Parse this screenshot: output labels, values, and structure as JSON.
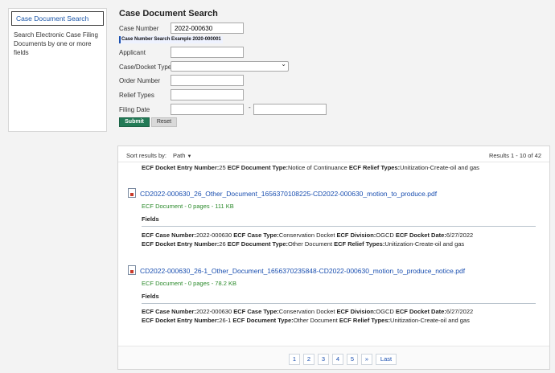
{
  "sidebar": {
    "tab_label": "Case Document Search",
    "description": "Search Electronic Case Filing Documents by one or more fields"
  },
  "form": {
    "title": "Case Document Search",
    "case_number_label": "Case Number",
    "case_number_value": "2022-000630",
    "hint": "Case Number Search Example 2020-000001",
    "applicant_label": "Applicant",
    "case_docket_type_label": "Case/Docket Type",
    "order_number_label": "Order Number",
    "relief_types_label": "Relief Types",
    "filing_date_label": "Filing Date",
    "filing_date_separator": "-",
    "submit_label": "Submit",
    "reset_label": "Reset"
  },
  "results": {
    "sort_label": "Sort results by:",
    "sort_value": "Path",
    "count": "Results  1 - 10 of 42",
    "first_partial": {
      "k1": "ECF Docket Entry Number:",
      "v1": "25",
      "k2": "ECF Document Type:",
      "v2": "Notice of Continuance",
      "k3": "ECF Relief Types:",
      "v3": "Unitization-Create-oil and gas"
    },
    "items": [
      {
        "title": "CD2022-000630_26_Other_Document_1656370108225-CD2022-000630_motion_to_produce.pdf",
        "size": "ECF Document - 0 pages - 111 KB",
        "fields_label": "Fields",
        "line1": {
          "k1": "ECF Case Number:",
          "v1": "2022-000630",
          "k2": "ECF Case Type:",
          "v2": "Conservation Docket",
          "k3": "ECF Division:",
          "v3": "OGCD",
          "k4": "ECF Docket Date:",
          "v4": "6/27/2022"
        },
        "line2": {
          "k1": "ECF Docket Entry Number:",
          "v1": "26",
          "k2": "ECF Document Type:",
          "v2": "Other Document",
          "k3": "ECF Relief Types:",
          "v3": "Unitization-Create-oil and gas"
        }
      },
      {
        "title": "CD2022-000630_26-1_Other_Document_1656370235848-CD2022-000630_motion_to_produce_notice.pdf",
        "size": "ECF Document - 0 pages - 78.2 KB",
        "fields_label": "Fields",
        "line1": {
          "k1": "ECF Case Number:",
          "v1": "2022-000630",
          "k2": "ECF Case Type:",
          "v2": "Conservation Docket",
          "k3": "ECF Division:",
          "v3": "OGCD",
          "k4": "ECF Docket Date:",
          "v4": "6/27/2022"
        },
        "line2": {
          "k1": "ECF Docket Entry Number:",
          "v1": "26-1",
          "k2": "ECF Document Type:",
          "v2": "Other Document",
          "k3": "ECF Relief Types:",
          "v3": "Unitization-Create-oil and gas"
        }
      }
    ]
  },
  "pagination": {
    "pages": [
      "1",
      "2",
      "3",
      "4",
      "5"
    ],
    "next": "»",
    "last": "Last"
  }
}
